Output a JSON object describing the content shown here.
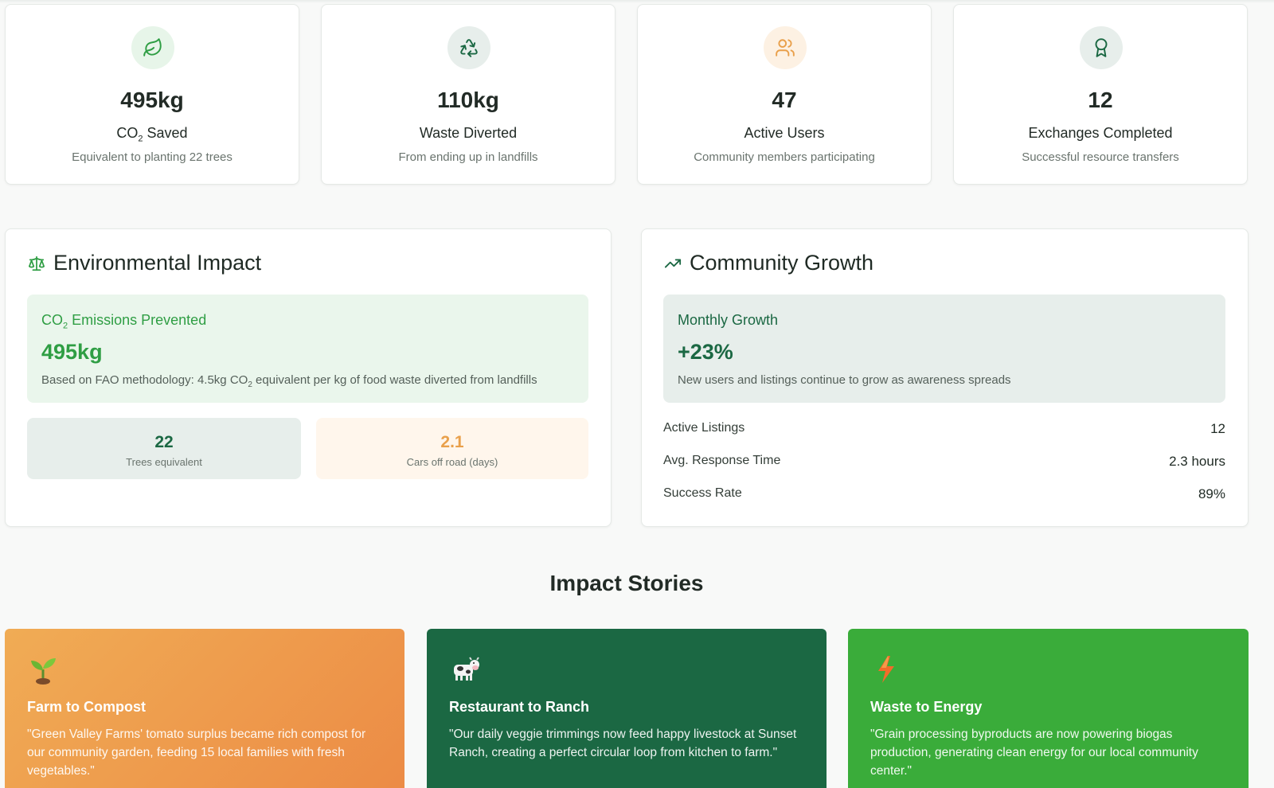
{
  "colors": {
    "brand_green": "#2f9e44",
    "dark_green": "#1b6843",
    "orange": "#e9a04b",
    "orange_card": "#ec9a48",
    "bright_green_card": "#3aac3a"
  },
  "stats": [
    {
      "icon": "leaf-icon",
      "value": "495kg",
      "label_main": "CO",
      "label_sub": "2",
      "label_rest": " Saved",
      "note": "Equivalent to planting 22 trees"
    },
    {
      "icon": "recycle-icon",
      "value": "110kg",
      "label": "Waste Diverted",
      "note": "From ending up in landfills"
    },
    {
      "icon": "users-icon",
      "value": "47",
      "label": "Active Users",
      "note": "Community members participating"
    },
    {
      "icon": "award-icon",
      "value": "12",
      "label": "Exchanges Completed",
      "note": "Successful resource transfers"
    }
  ],
  "environmental": {
    "title": "Environmental Impact",
    "icon": "scale-icon",
    "box_title_main": "CO",
    "box_title_sub": "2",
    "box_title_rest": " Emissions Prevented",
    "box_value": "495kg",
    "note_part1": "Based on FAO methodology: 4.5kg CO",
    "note_sub": "2",
    "note_part2": " equivalent per kg of food waste diverted from landfills",
    "trees_value": "22",
    "trees_label": "Trees equivalent",
    "cars_value": "2.1",
    "cars_label": "Cars off road (days)"
  },
  "community": {
    "title": "Community Growth",
    "icon": "trending-up-icon",
    "box_title": "Monthly Growth",
    "box_value": "+23%",
    "box_note": "New users and listings continue to grow as awareness spreads",
    "metrics": [
      {
        "label": "Active Listings",
        "value": "12"
      },
      {
        "label": "Avg. Response Time",
        "value": "2.3 hours"
      },
      {
        "label": "Success Rate",
        "value": "89%"
      }
    ]
  },
  "stories_heading": "Impact Stories",
  "stories": [
    {
      "icon": "seedling-icon",
      "title": "Farm to Compost",
      "text": "\"Green Valley Farms' tomato surplus became rich compost for our community garden, feeding 15 local families with fresh vegetables.\""
    },
    {
      "icon": "cow-icon",
      "title": "Restaurant to Ranch",
      "text": "\"Our daily veggie trimmings now feed happy livestock at Sunset Ranch, creating a perfect circular loop from kitchen to farm.\""
    },
    {
      "icon": "lightning-icon",
      "title": "Waste to Energy",
      "text": "\"Grain processing byproducts are now powering biogas production, generating clean energy for our local community center.\""
    }
  ]
}
